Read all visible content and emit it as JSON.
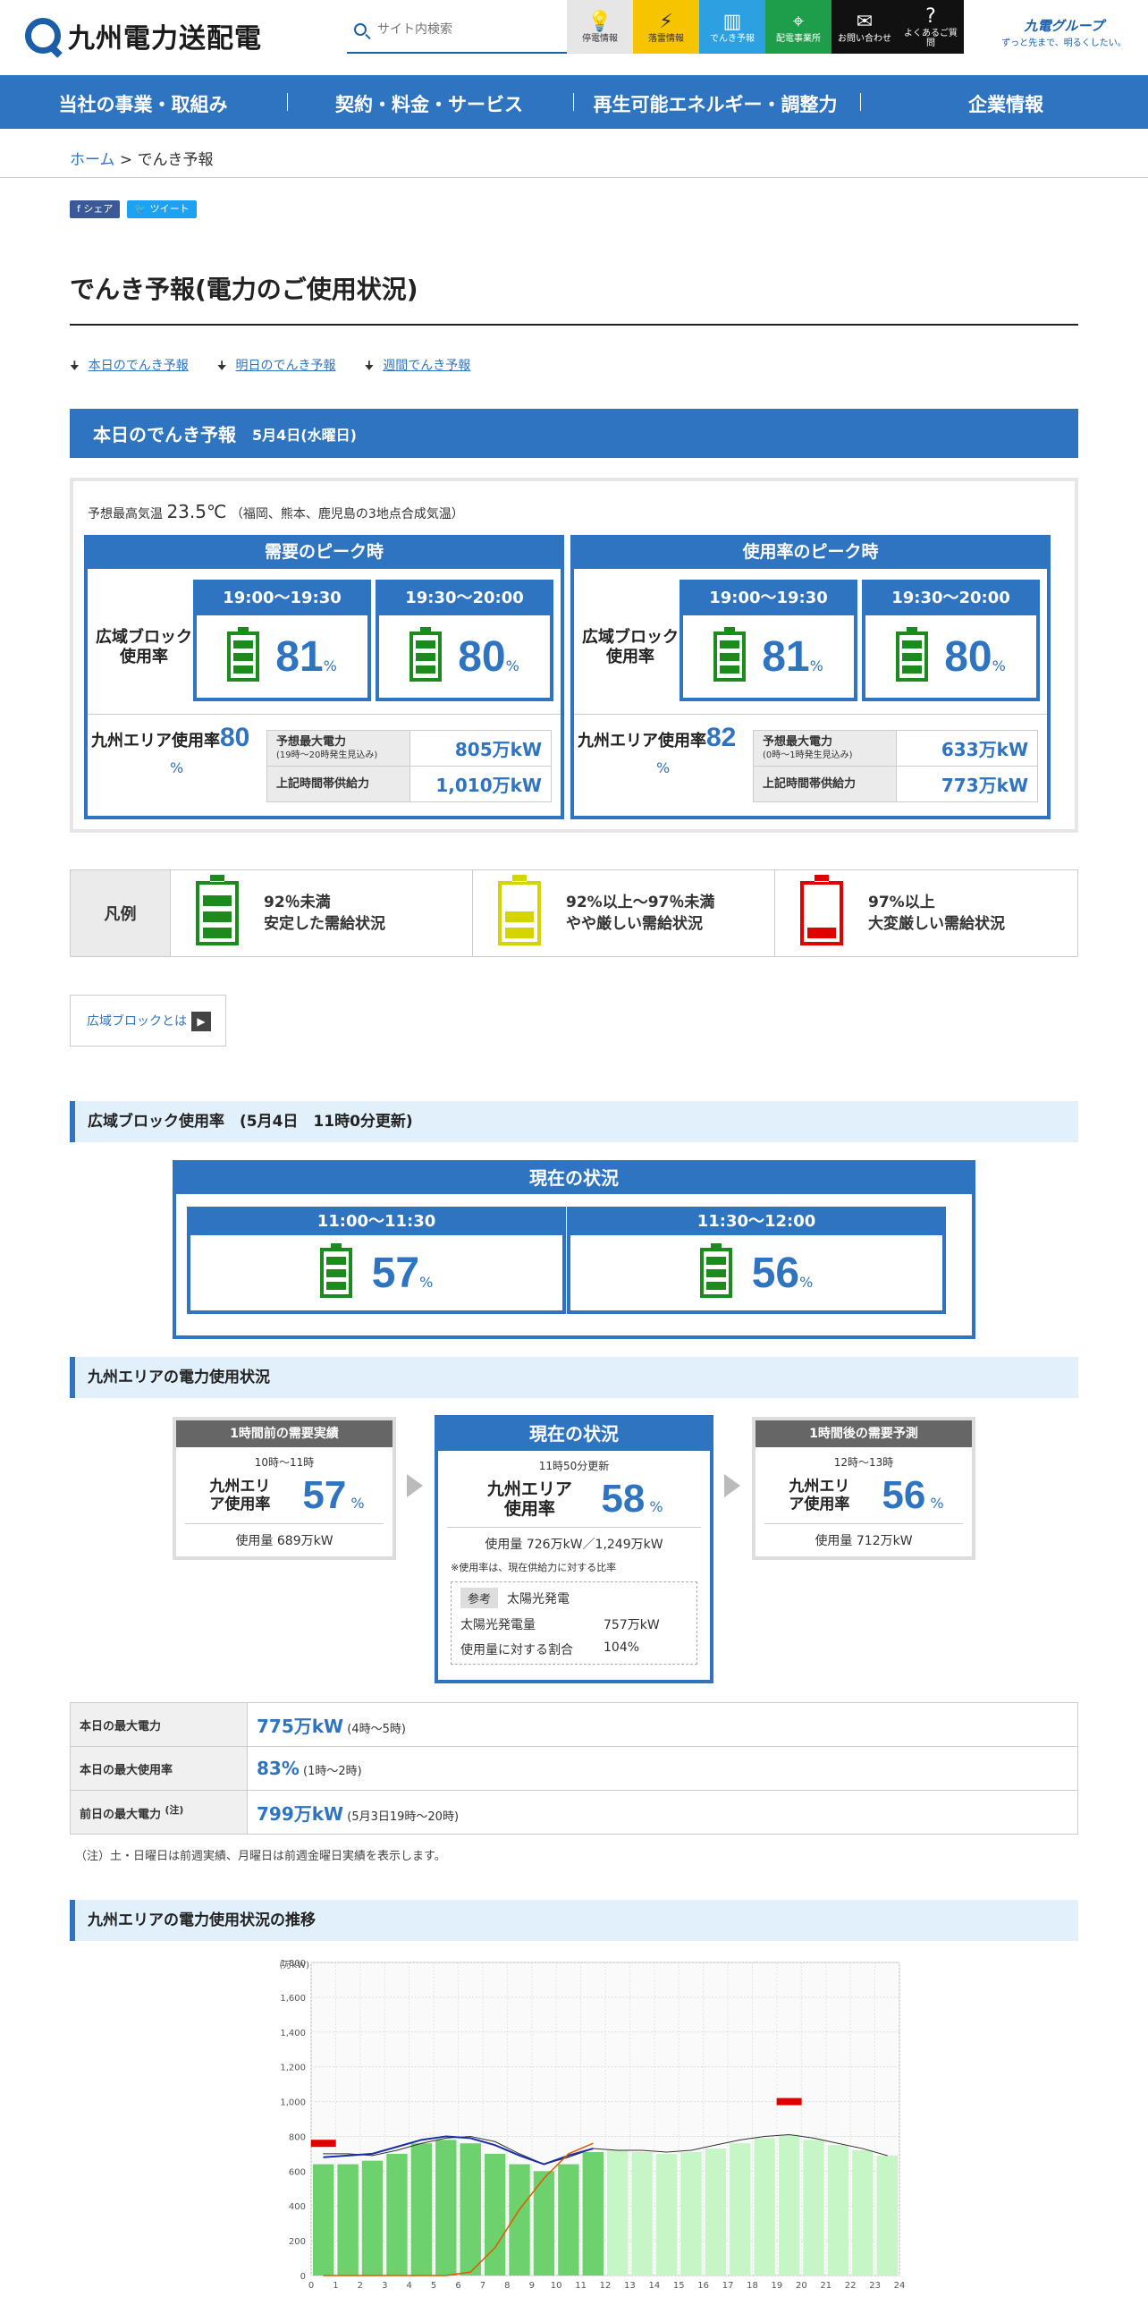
{
  "header": {
    "logo_text": "九州電力送配電",
    "search_placeholder": "サイト内検索",
    "quick_nav": [
      {
        "label": "停電情報",
        "glyph": "💡",
        "icon": "lightbulb-icon",
        "bg": "#e6e6e6",
        "fg": "#333333"
      },
      {
        "label": "落雷情報",
        "glyph": "⚡",
        "icon": "lightning-icon",
        "bg": "#f6c400",
        "fg": "#333333"
      },
      {
        "label": "でんき予報",
        "glyph": "▥",
        "icon": "battery-icon",
        "bg": "#2ca0e0",
        "fg": "#ffffff"
      },
      {
        "label": "配電事業所",
        "glyph": "⌖",
        "icon": "location-pin-icon",
        "bg": "#1e9e4a",
        "fg": "#ffffff"
      },
      {
        "label": "お問い合わせ",
        "glyph": "✉",
        "icon": "mail-icon",
        "bg": "#111111",
        "fg": "#ffffff"
      },
      {
        "label": "よくあるご質問",
        "glyph": "?",
        "icon": "question-icon",
        "bg": "#111111",
        "fg": "#ffffff"
      }
    ],
    "group_name": "九電グループ",
    "group_slogan": "ずっと先まで、明るくしたい。"
  },
  "main_nav": [
    "当社の事業・取組み",
    "契約・料金・サービス",
    "再生可能エネルギー・調整力",
    "企業情報"
  ],
  "breadcrumb": {
    "home": "ホーム",
    "separator": " > ",
    "current": "でんき予報"
  },
  "share": {
    "facebook": "シェア",
    "twitter": "ツイート"
  },
  "page_title": "でんき予報(電力のご使用状況)",
  "anchors": [
    "本日のでんき予報",
    "明日のでんき予報",
    "週間でんき予報"
  ],
  "today": {
    "title": "本日のでんき予報",
    "date": "5月4日(水曜日)",
    "temp_label": "予想最高気温",
    "temp_value": "23.5℃",
    "temp_note": "（福岡、熊本、鹿児島の3地点合成気温）",
    "block_label": "広域ブロック使用率",
    "area_label": "九州エリア使用率",
    "pct_unit": "%",
    "panels": [
      {
        "title": "需要のピーク時",
        "slots": [
          {
            "time": "19:00～19:30",
            "value": "81"
          },
          {
            "time": "19:30～20:00",
            "value": "80"
          }
        ],
        "area_value": "80",
        "max_label": "予想最大電力",
        "max_note": "(19時～20時発生見込み)",
        "max_value": "805万kW",
        "supply_label": "上記時間帯供給力",
        "supply_value": "1,010万kW"
      },
      {
        "title": "使用率のピーク時",
        "slots": [
          {
            "time": "19:00～19:30",
            "value": "81"
          },
          {
            "time": "19:30～20:00",
            "value": "80"
          }
        ],
        "area_value": "82",
        "max_label": "予想最大電力",
        "max_note": "(0時～1時発生見込み)",
        "max_value": "633万kW",
        "supply_label": "上記時間帯供給力",
        "supply_value": "773万kW"
      }
    ]
  },
  "legend": {
    "title": "凡例",
    "items": [
      {
        "range": "92％未満",
        "desc": "安定した需給状況",
        "color": "#1c8a1c"
      },
      {
        "range": "92%以上～97％未満",
        "desc": "やや厳しい需給状況",
        "color": "#d4d400"
      },
      {
        "range": "97%以上",
        "desc": "大変厳しい需給状況",
        "color": "#e00000"
      }
    ]
  },
  "wide_block_link": "広域ブロックとは",
  "block_section": {
    "title": "広域ブロック使用率　(5月4日　11時0分更新)",
    "current_title": "現在の状況",
    "slots": [
      {
        "time": "11:00～11:30",
        "value": "57"
      },
      {
        "time": "11:30～12:00",
        "value": "56"
      }
    ]
  },
  "area_section": {
    "title": "九州エリアの電力使用状況",
    "prev": {
      "header": "1時間前の需要実績",
      "time": "10時～11時",
      "label": "九州エリア使用率",
      "value": "57",
      "usage": "使用量 689万kW"
    },
    "current": {
      "header": "現在の状況",
      "time": "11時50分更新",
      "label": "九州エリア使用率",
      "value": "58",
      "usage": "使用量 726万kW／1,249万kW",
      "note": "※使用率は、現在供給力に対する比率",
      "ref_tag": "参考",
      "ref_title": "太陽光発電",
      "solar_label": "太陽光発電量",
      "solar_value": "757万kW",
      "ratio_label": "使用量に対する割合",
      "ratio_value": "104%"
    },
    "next": {
      "header": "1時間後の需要予測",
      "time": "12時～13時",
      "label": "九州エリア使用率",
      "value": "56",
      "usage": "使用量 712万kW"
    }
  },
  "max_table": [
    {
      "label": "本日の最大電力",
      "value": "775万kW",
      "note": "(4時～5時)"
    },
    {
      "label": "本日の最大使用率",
      "value": "83%",
      "note": "(1時～2時)"
    },
    {
      "label": "前日の最大電力",
      "sup": "(注)",
      "value": "799万kW",
      "note": "(5月3日19時～20時)"
    }
  ],
  "footnote": "（注）土・日曜日は前週実績、月曜日は前週金曜日実績を表示します。",
  "trend_title": "九州エリアの電力使用状況の推移",
  "chart_data": {
    "type": "bar",
    "y_unit": "(万kW)",
    "ylim": [
      0,
      1800
    ],
    "y_ticks": [
      "0",
      "200",
      "400",
      "600",
      "800",
      "1,000",
      "1,200",
      "1,400",
      "1,600",
      "1,800"
    ],
    "x_ticks": [
      "0",
      "1",
      "2",
      "3",
      "4",
      "5",
      "6",
      "7",
      "8",
      "9",
      "10",
      "11",
      "12",
      "13",
      "14",
      "15",
      "16",
      "17",
      "18",
      "19",
      "20",
      "21",
      "22",
      "23",
      "24"
    ],
    "grid": true,
    "series": [
      {
        "name": "",
        "values": [
          640,
          640,
          660,
          700,
          760,
          780,
          760,
          700,
          640,
          600,
          640,
          710,
          0,
          0,
          0,
          0,
          0,
          0,
          0,
          0,
          0,
          0,
          0,
          0
        ],
        "color": "#6dd16d"
      },
      {
        "name": "",
        "values": [
          0,
          0,
          0,
          0,
          0,
          0,
          0,
          0,
          0,
          0,
          0,
          0,
          720,
          710,
          700,
          710,
          730,
          760,
          790,
          810,
          780,
          750,
          720,
          690
        ],
        "color": "#c6f5c6"
      }
    ],
    "demand_line": [
      680,
      690,
      700,
      740,
      780,
      800,
      790,
      750,
      690,
      640,
      690,
      730
    ],
    "previous_line": [
      700,
      700,
      690,
      720,
      760,
      790,
      800,
      770,
      700,
      640,
      680,
      730,
      720,
      720,
      710,
      720,
      750,
      780,
      800,
      810,
      790,
      760,
      730,
      690
    ],
    "solar_line": [
      0,
      0,
      0,
      0,
      0,
      0,
      20,
      160,
      380,
      560,
      700,
      760
    ],
    "peak_markers": [
      {
        "x": 0.5,
        "y": 760
      },
      {
        "x": 19.5,
        "y": 1000
      }
    ]
  }
}
